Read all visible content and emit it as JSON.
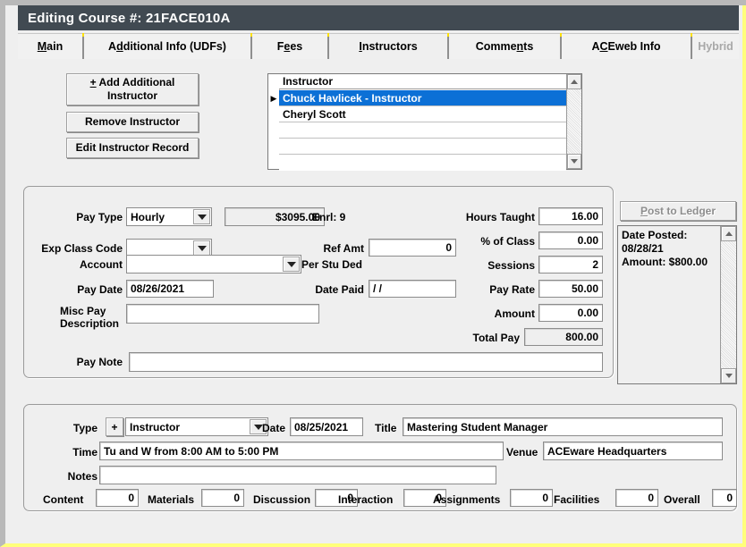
{
  "window": {
    "title": "Editing Course #: 21FACE010A"
  },
  "tabs": [
    {
      "label": "Main",
      "accel": "M",
      "selected": false,
      "disabled": false
    },
    {
      "label": "Additional Info (UDFs)",
      "accel": "d",
      "selected": false,
      "disabled": false
    },
    {
      "label": "Fees",
      "accel": "e",
      "selected": false,
      "disabled": false
    },
    {
      "label": "Instructors",
      "accel": "I",
      "selected": true,
      "disabled": false
    },
    {
      "label": "Comments",
      "accel": "n",
      "selected": false,
      "disabled": false
    },
    {
      "label": "ACEweb Info",
      "accel": "C",
      "selected": false,
      "disabled": false
    },
    {
      "label": "Hybrid",
      "accel": "",
      "selected": false,
      "disabled": true
    }
  ],
  "instructor_actions": {
    "add_label": "+ Add Additional Instructor",
    "remove_label": "Remove Instructor",
    "edit_label": "Edit Instructor Record"
  },
  "instructor_grid": {
    "header": "Instructor",
    "rows": [
      {
        "name": "Chuck Havlicek - Instructor",
        "selected": true,
        "marker": "▶"
      },
      {
        "name": "Cheryl Scott",
        "selected": false,
        "marker": ""
      },
      {
        "name": "",
        "selected": false,
        "marker": ""
      },
      {
        "name": "",
        "selected": false,
        "marker": ""
      },
      {
        "name": "",
        "selected": false,
        "marker": ""
      }
    ]
  },
  "pay": {
    "pay_type_label": "Pay Type",
    "pay_type_value": "Hourly",
    "pay_total_display": "$3095.00",
    "exp_class_code_label": "Exp Class Code",
    "exp_class_code_value": "",
    "account_label": "Account",
    "account_value": "",
    "pay_date_label": "Pay Date",
    "pay_date_value": "08/26/2021",
    "misc_pay_description_label": "Misc Pay Description",
    "misc_pay_description_value": "",
    "pay_note_label": "Pay Note",
    "pay_note_value": "",
    "enrl_label": "Enrl: 9",
    "ref_amt_label": "Ref Amt",
    "ref_amt_value": "0",
    "per_stu_ded_label": "Per Stu Ded",
    "date_paid_label": "Date Paid",
    "date_paid_value": "/  /",
    "hours_taught_label": "Hours Taught",
    "hours_taught_value": "16.00",
    "pct_of_class_label": "% of Class",
    "pct_of_class_value": "0.00",
    "sessions_label": "Sessions",
    "sessions_value": "2",
    "pay_rate_label": "Pay Rate",
    "pay_rate_value": "50.00",
    "amount_label": "Amount",
    "amount_value": "0.00",
    "total_pay_label": "Total Pay",
    "total_pay_value": "800.00"
  },
  "ledger": {
    "post_button_label": "Post to Ledger",
    "post_button_accel": "P",
    "entry_text": "Date Posted:\n08/28/21\nAmount: $800.00"
  },
  "detail": {
    "type_label": "Type",
    "type_add_label": "+",
    "type_value": "Instructor",
    "date_label": "Date",
    "date_value": "08/25/2021",
    "title_label": "Title",
    "title_value": "Mastering Student Manager",
    "time_label": "Time",
    "time_value": "Tu and W from 8:00 AM to 5:00 PM",
    "venue_label": "Venue",
    "venue_value": "ACEware Headquarters",
    "notes_label": "Notes",
    "notes_value": "",
    "ratings": [
      {
        "label": "Content",
        "value": "0"
      },
      {
        "label": "Materials",
        "value": "0"
      },
      {
        "label": "Discussion",
        "value": "0"
      },
      {
        "label": "Interaction",
        "value": "0"
      },
      {
        "label": "Assignments",
        "value": "0"
      },
      {
        "label": "Facilities",
        "value": "0"
      },
      {
        "label": "Overall",
        "value": "0"
      }
    ]
  },
  "colors": {
    "titlebar_bg": "#414a52",
    "selection_blue": "#0c70d6",
    "window_bg": "#efefef",
    "accent_yellow": "#ffff7a"
  }
}
